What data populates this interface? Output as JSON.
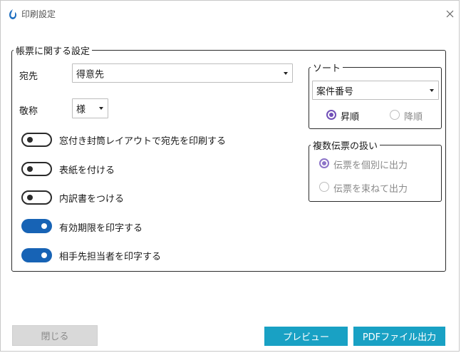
{
  "window": {
    "title": "印刷設定"
  },
  "main_group": {
    "legend": "帳票に関する設定",
    "destination": {
      "label": "宛先",
      "value": "得意先"
    },
    "honorific": {
      "label": "敬称",
      "value": "様"
    },
    "toggles": [
      {
        "label": "窓付き封筒レイアウトで宛先を印刷する",
        "on": false
      },
      {
        "label": "表紙を付ける",
        "on": false
      },
      {
        "label": "内訳書をつける",
        "on": false
      },
      {
        "label": "有効期限を印字する",
        "on": true
      },
      {
        "label": "相手先担当者を印字する",
        "on": true
      }
    ]
  },
  "sort_group": {
    "legend": "ソート",
    "field": "案件番号",
    "ascending": "昇順",
    "descending": "降順",
    "selected": "ascending"
  },
  "multi_group": {
    "legend": "複数伝票の扱い",
    "individual": "伝票を個別に出力",
    "bundle": "伝票を束ねて出力",
    "selected": "individual"
  },
  "buttons": {
    "close": "閉じる",
    "preview": "プレビュー",
    "pdf": "PDFファイル出力"
  },
  "colors": {
    "accent_button": "#19a1c4",
    "toggle_on": "#1763b5",
    "radio_selected": "#7150b8"
  }
}
